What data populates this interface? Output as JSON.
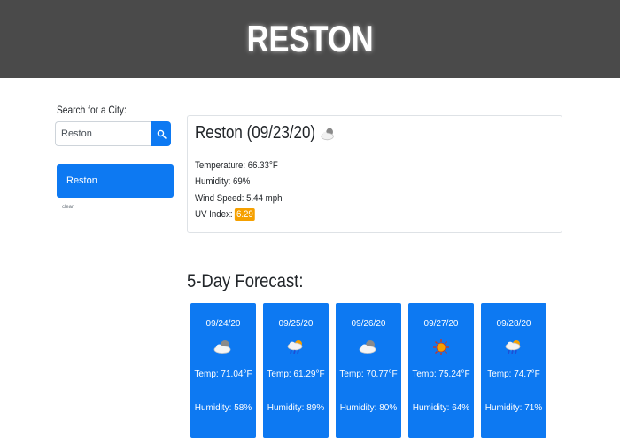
{
  "header": {
    "title": "RESTON"
  },
  "search": {
    "label": "Search for a City:",
    "value": "Reston",
    "placeholder": ""
  },
  "history": [
    {
      "city": "Reston"
    }
  ],
  "clear_label": "clear",
  "current": {
    "title": "Reston (09/23/20)",
    "icon": "partly-cloudy-icon",
    "temperature_text": "Temperature: 66.33°F",
    "humidity_text": "Humidity: 69%",
    "wind_text": "Wind Speed: 5.44 mph",
    "uv_label": "UV Index:",
    "uv_value": "6.29",
    "uv_color": "#f5a000"
  },
  "forecast": {
    "title": "5-Day Forecast:",
    "days": [
      {
        "date": "09/24/20",
        "icon": "partly-cloudy-icon",
        "temp": "Temp: 71.04°F",
        "humidity": "Humidity: 58%"
      },
      {
        "date": "09/25/20",
        "icon": "rain-sun-icon",
        "temp": "Temp: 61.29°F",
        "humidity": "Humidity: 89%"
      },
      {
        "date": "09/26/20",
        "icon": "partly-cloudy-icon",
        "temp": "Temp: 70.77°F",
        "humidity": "Humidity: 80%"
      },
      {
        "date": "09/27/20",
        "icon": "sun-icon",
        "temp": "Temp: 75.24°F",
        "humidity": "Humidity: 64%"
      },
      {
        "date": "09/28/20",
        "icon": "rain-sun-icon",
        "temp": "Temp: 74.7°F",
        "humidity": "Humidity: 71%"
      }
    ]
  },
  "colors": {
    "header_bg": "#4a4a4a",
    "accent": "#0d79f2",
    "uv_moderate": "#f5a000"
  }
}
